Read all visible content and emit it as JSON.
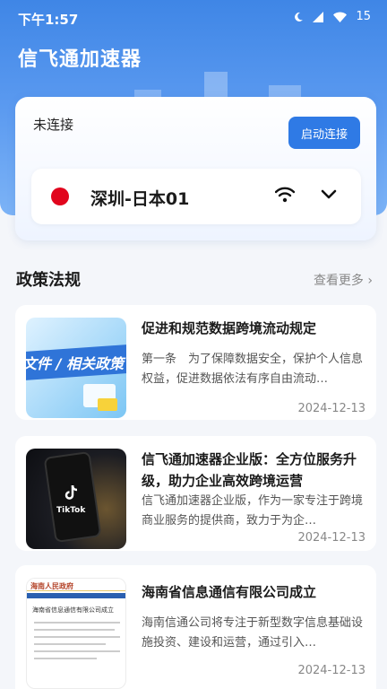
{
  "statusbar": {
    "time": "下午1:57",
    "battery": "15"
  },
  "app": {
    "title": "信飞通加速器"
  },
  "connection": {
    "status": "未连接",
    "button_label": "启动连接",
    "server_name": "深圳-日本01"
  },
  "news_section": {
    "title": "政策法规",
    "more_label": "查看更多"
  },
  "news": [
    {
      "title": "促进和规范数据跨境流动规定",
      "description": "第一条　为了保障数据安全，保护个人信息权益，促进数据依法有序自由流动…",
      "date": "2024-12-13",
      "thumb_text": "文件 / 相关政策"
    },
    {
      "title": "信飞通加速器企业版：全方位服务升级，助力企业高效跨境运营",
      "description": "信飞通加速器企业版，作为一家专注于跨境商业服务的提供商，致力于为企…",
      "date": "2024-12-13",
      "thumb_text": "TikTok"
    },
    {
      "title": "海南省信息通信有限公司成立",
      "description": "海南信通公司将专注于新型数字信息基础设施投资、建设和运营，通过引入…",
      "date": "2024-12-13",
      "thumb_text": "海南省信息通信有限公司成立"
    }
  ],
  "colors": {
    "accent": "#2f7ae5",
    "flag": "#e1051d"
  }
}
